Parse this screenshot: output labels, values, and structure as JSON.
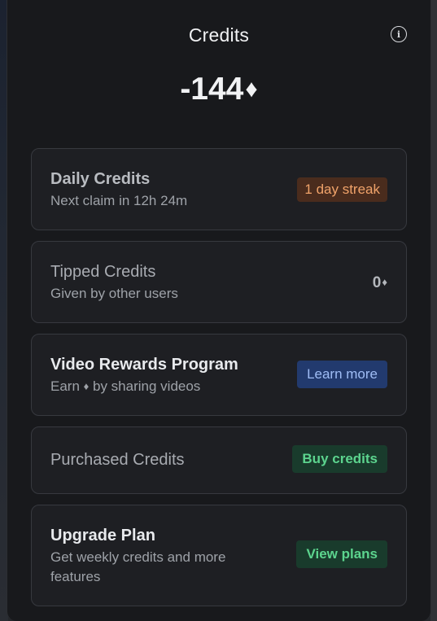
{
  "header": {
    "title": "Credits",
    "info_icon": "info-icon",
    "info_glyph": "i"
  },
  "balance": {
    "value": "-144",
    "currency_glyph": "♦"
  },
  "cards": {
    "daily": {
      "title": "Daily Credits",
      "subtitle": "Next claim in 12h 24m",
      "badge": "1 day streak"
    },
    "tipped": {
      "title": "Tipped Credits",
      "subtitle": "Given by other users",
      "value": "0",
      "currency_glyph": "♦"
    },
    "video": {
      "title": "Video Rewards Program",
      "subtitle_before": "Earn ",
      "currency_glyph": "♦",
      "subtitle_after": " by sharing videos",
      "button": "Learn more"
    },
    "purchased": {
      "title": "Purchased Credits",
      "button": "Buy credits"
    },
    "upgrade": {
      "title": "Upgrade Plan",
      "subtitle_line1": "Get weekly credits and more",
      "subtitle_line2": "features",
      "button": "View plans"
    }
  },
  "colors": {
    "panel_bg": "#18191c",
    "card_bg": "#1e1f23",
    "card_border": "#37393f",
    "streak_bg": "#4a2c1d",
    "streak_text": "#f0a36a",
    "learn_bg": "#223a6e",
    "learn_text": "#9fbdf5",
    "green_bg": "#193b2c",
    "green_text": "#5cd48e"
  }
}
